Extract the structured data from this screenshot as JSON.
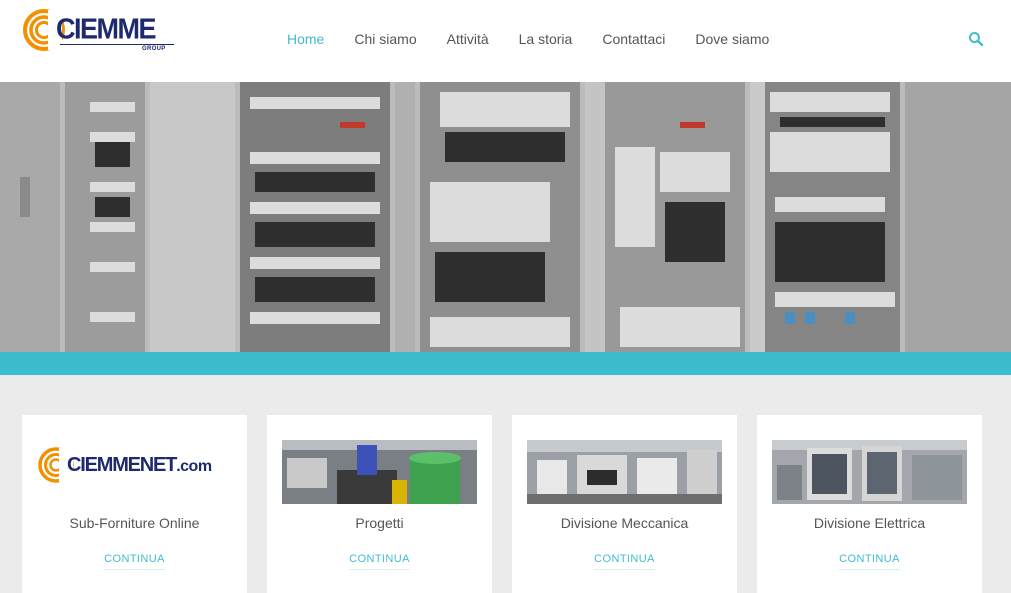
{
  "brand": {
    "logo_text": "CIEMME",
    "logo_sub": "GROUP",
    "colors": {
      "accent": "#3fbcd0",
      "brand_navy": "#1d2a6e",
      "brand_orange": "#f29000",
      "teal_bar": "#3dbccd"
    }
  },
  "nav": {
    "items": [
      {
        "label": "Home",
        "active": true
      },
      {
        "label": "Chi siamo"
      },
      {
        "label": "Attività"
      },
      {
        "label": "La storia"
      },
      {
        "label": "Contattaci"
      },
      {
        "label": "Dove siamo"
      }
    ],
    "search_icon": "search-icon"
  },
  "cards": [
    {
      "title": "Sub-Forniture Online",
      "link": "CONTINUA",
      "logo_text": "CIEMMENET",
      "logo_suffix": ".com"
    },
    {
      "title": "Progetti",
      "link": "CONTINUA"
    },
    {
      "title": "Divisione Meccanica",
      "link": "CONTINUA"
    },
    {
      "title": "Divisione Elettrica",
      "link": "CONTINUA"
    }
  ]
}
